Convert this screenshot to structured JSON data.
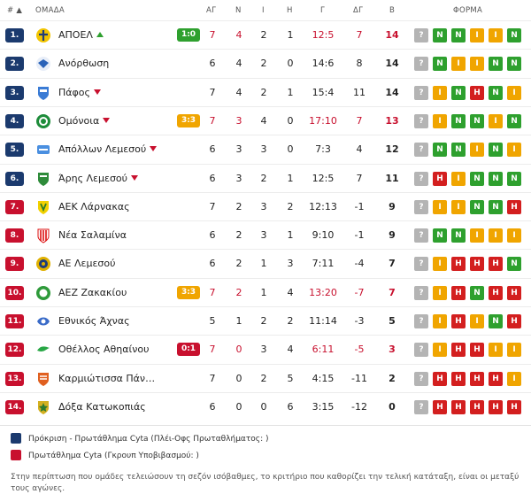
{
  "header": {
    "rank": "# ▲",
    "team": "ΟΜΑΔΑ",
    "played": "ΑΓ",
    "wins": "Ν",
    "draws": "Ι",
    "losses": "Η",
    "goals": "Γ",
    "diff": "ΔΓ",
    "points": "Β",
    "form": "ΦΟΡΜΑ"
  },
  "rows": [
    {
      "rank": "1.",
      "zone": "blue",
      "team": "ΑΠΟΕΛ",
      "trend": "up",
      "live": "1:0",
      "live_color": "green",
      "played": "7",
      "wins": "4",
      "draws": "2",
      "losses": "1",
      "goals": "12:5",
      "diff": "7",
      "points": "14",
      "highlight": true,
      "form": [
        "?",
        "N",
        "N",
        "I",
        "I",
        "N"
      ],
      "logo": "cross-logo"
    },
    {
      "rank": "2.",
      "zone": "blue",
      "team": "Ανόρθωση",
      "trend": "",
      "live": "",
      "played": "6",
      "wins": "4",
      "draws": "2",
      "losses": "0",
      "goals": "14:6",
      "diff": "8",
      "points": "14",
      "highlight": false,
      "form": [
        "?",
        "N",
        "I",
        "I",
        "N",
        "N"
      ],
      "logo": "wings-logo"
    },
    {
      "rank": "3.",
      "zone": "blue",
      "team": "Πάφος",
      "trend": "down",
      "live": "",
      "played": "7",
      "wins": "4",
      "draws": "2",
      "losses": "1",
      "goals": "15:4",
      "diff": "11",
      "points": "14",
      "highlight": false,
      "form": [
        "?",
        "I",
        "N",
        "H",
        "N",
        "I"
      ],
      "logo": "shield-logo"
    },
    {
      "rank": "4.",
      "zone": "blue",
      "team": "Ομόνοια",
      "trend": "down",
      "live": "3:3",
      "live_color": "orange",
      "played": "7",
      "wins": "3",
      "draws": "4",
      "losses": "0",
      "goals": "17:10",
      "diff": "7",
      "points": "13",
      "highlight": true,
      "form": [
        "?",
        "I",
        "N",
        "N",
        "I",
        "N"
      ],
      "logo": "clover-logo"
    },
    {
      "rank": "5.",
      "zone": "blue",
      "team": "Απόλλων Λεμεσού",
      "trend": "down",
      "live": "",
      "played": "6",
      "wins": "3",
      "draws": "3",
      "losses": "0",
      "goals": "7:3",
      "diff": "4",
      "points": "12",
      "highlight": false,
      "form": [
        "?",
        "N",
        "N",
        "I",
        "N",
        "I"
      ],
      "logo": "apollon-logo"
    },
    {
      "rank": "6.",
      "zone": "blue",
      "team": "Άρης Λεμεσού",
      "trend": "down",
      "live": "",
      "played": "6",
      "wins": "3",
      "draws": "2",
      "losses": "1",
      "goals": "12:5",
      "diff": "7",
      "points": "11",
      "highlight": false,
      "form": [
        "?",
        "H",
        "I",
        "N",
        "N",
        "N"
      ],
      "logo": "aris-logo"
    },
    {
      "rank": "7.",
      "zone": "red",
      "team": "ΑΕΚ Λάρνακας",
      "trend": "",
      "live": "",
      "played": "7",
      "wins": "2",
      "draws": "3",
      "losses": "2",
      "goals": "12:13",
      "diff": "-1",
      "points": "9",
      "highlight": false,
      "form": [
        "?",
        "I",
        "I",
        "N",
        "N",
        "H"
      ],
      "logo": "aek-logo"
    },
    {
      "rank": "8.",
      "zone": "red",
      "team": "Νέα Σαλαμίνα",
      "trend": "",
      "live": "",
      "played": "6",
      "wins": "2",
      "draws": "3",
      "losses": "1",
      "goals": "9:10",
      "diff": "-1",
      "points": "9",
      "highlight": false,
      "form": [
        "?",
        "N",
        "N",
        "I",
        "I",
        "I"
      ],
      "logo": "salamina-logo"
    },
    {
      "rank": "9.",
      "zone": "red",
      "team": "ΑΕ Λεμεσού",
      "trend": "",
      "live": "",
      "played": "6",
      "wins": "2",
      "draws": "1",
      "losses": "3",
      "goals": "7:11",
      "diff": "-4",
      "points": "7",
      "highlight": false,
      "form": [
        "?",
        "I",
        "H",
        "H",
        "H",
        "N"
      ],
      "logo": "ael-logo"
    },
    {
      "rank": "10.",
      "zone": "red",
      "team": "ΑΕΖ Ζακακίου",
      "trend": "",
      "live": "3:3",
      "live_color": "orange",
      "played": "7",
      "wins": "2",
      "draws": "1",
      "losses": "4",
      "goals": "13:20",
      "diff": "-7",
      "points": "7",
      "highlight": true,
      "form": [
        "?",
        "I",
        "H",
        "N",
        "H",
        "H"
      ],
      "logo": "aez-logo"
    },
    {
      "rank": "11.",
      "zone": "red",
      "team": "Εθνικός Άχνας",
      "trend": "",
      "live": "",
      "played": "5",
      "wins": "1",
      "draws": "2",
      "losses": "2",
      "goals": "11:14",
      "diff": "-3",
      "points": "5",
      "highlight": false,
      "form": [
        "?",
        "I",
        "H",
        "I",
        "N",
        "H"
      ],
      "logo": "ethnikos-logo"
    },
    {
      "rank": "12.",
      "zone": "red",
      "team": "Οθέλλος Αθηαίνου",
      "trend": "",
      "live": "0:1",
      "live_color": "red",
      "played": "7",
      "wins": "0",
      "draws": "3",
      "losses": "4",
      "goals": "6:11",
      "diff": "-5",
      "points": "3",
      "highlight": true,
      "form": [
        "?",
        "I",
        "H",
        "H",
        "I",
        "I"
      ],
      "logo": "othellos-logo"
    },
    {
      "rank": "13.",
      "zone": "red",
      "team": "Καρμιώτισσα Πάν…",
      "trend": "",
      "live": "",
      "played": "7",
      "wins": "0",
      "draws": "2",
      "losses": "5",
      "goals": "4:15",
      "diff": "-11",
      "points": "2",
      "highlight": false,
      "form": [
        "?",
        "H",
        "H",
        "H",
        "H",
        "I"
      ],
      "logo": "karmiotissa-logo"
    },
    {
      "rank": "14.",
      "zone": "red",
      "team": "Δόξα Κατωκοπιάς",
      "trend": "",
      "live": "",
      "played": "6",
      "wins": "0",
      "draws": "0",
      "losses": "6",
      "goals": "3:15",
      "diff": "-12",
      "points": "0",
      "highlight": false,
      "form": [
        "?",
        "H",
        "H",
        "H",
        "H",
        "H"
      ],
      "logo": "doxa-logo"
    }
  ],
  "legend": [
    {
      "label": "Πρόκριση - Πρωτάθλημα Cyta (Πλέι-Οφς Πρωταθλήματος: )",
      "color": "#1b3a6e"
    },
    {
      "label": "Πρωτάθλημα Cyta (Γκρουπ Υποβιβασμού: )",
      "color": "#c8102e"
    }
  ],
  "note": "Στην περίπτωση που ομάδες τελειώσουν τη σεζόν ισόβαθμες, το κριτήριο που καθορίζει την τελική κατάταξη, είναι οι μεταξύ τους αγώνες.",
  "colors": {
    "win": "#2ea02e",
    "draw": "#f0a500",
    "loss": "#d31f1f",
    "unknown": "#b4b4b4"
  }
}
